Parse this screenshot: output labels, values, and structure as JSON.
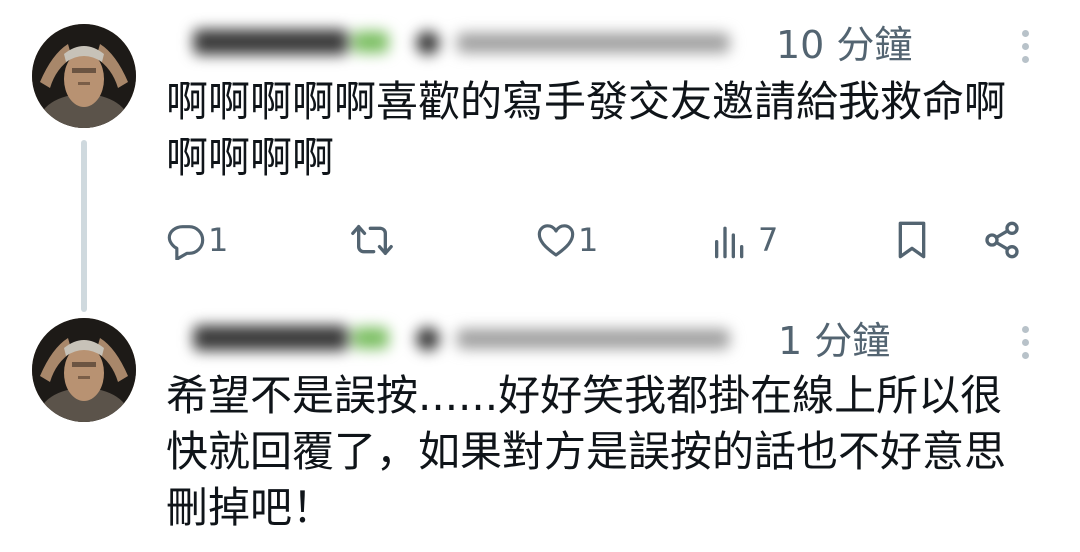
{
  "tweets": [
    {
      "timestamp": "10 分鐘",
      "text": "啊啊啊啊啊喜歡的寫手發交友邀請給我救命啊\n啊啊啊啊",
      "actions": {
        "reply_count": "1",
        "like_count": "1",
        "views_count": "7"
      }
    },
    {
      "timestamp": "1 分鐘",
      "text": "希望不是誤按......好好笑我都掛在線上所以很\n快就回覆了，如果對方是誤按的話也不好意思\n刪掉吧！"
    }
  ],
  "colors": {
    "text": "#0f1419",
    "secondary": "#536471",
    "thread_line": "#cfd9de"
  },
  "icons": [
    "reply-icon",
    "retweet-icon",
    "like-icon",
    "views-icon",
    "bookmark-icon",
    "share-icon",
    "more-icon"
  ]
}
